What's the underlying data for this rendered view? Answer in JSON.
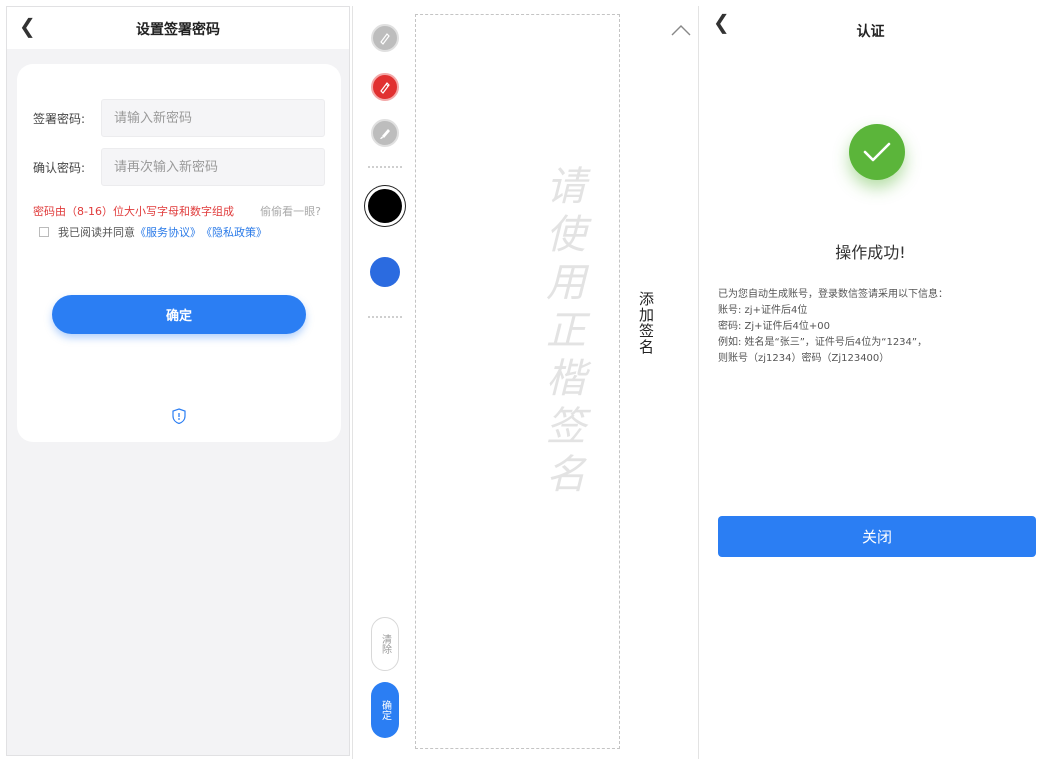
{
  "set_password": {
    "title": "设置签署密码",
    "password_label": "签署密码:",
    "password_placeholder": "请输入新密码",
    "confirm_label": "确认密码:",
    "confirm_placeholder": "请再次输入新密码",
    "rule_text": "密码由（8-16）位大小写字母和数字组成",
    "peek_text": "偷偷看一眼?",
    "agree_text": "我已阅读并同意",
    "service_link": "《服务协议》",
    "privacy_link": "《隐私政策》",
    "confirm_button": "确定",
    "colors": {
      "accent": "#2b7ef3",
      "error": "#e03b3b"
    }
  },
  "signature": {
    "watermark": "请使用正楷签名",
    "add_label": "添加签名",
    "clear_button": "清除",
    "confirm_button": "确定",
    "tools": [
      "pen-icon",
      "pencil-icon",
      "brush-icon"
    ],
    "colors": [
      "#000000",
      "#2b6be0"
    ],
    "active_tool_color": "#e13030"
  },
  "result": {
    "title": "认证",
    "success_text": "操作成功!",
    "info_lines": [
      "已为您自动生成账号，登录数信签请采用以下信息：",
      "账号: zj+证件后4位",
      "密码: Zj+证件后4位+00",
      "例如: 姓名是“张三”，证件号后4位为“1234”，",
      "则账号（zj1234）密码（Zj123400）"
    ],
    "close_button": "关闭",
    "success_color": "#5bb53a"
  }
}
